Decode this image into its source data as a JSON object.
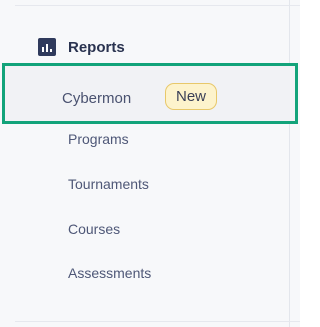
{
  "section": {
    "icon": "bar-chart-icon",
    "title": "Reports"
  },
  "active_item": {
    "label": "Cybermon",
    "badge": "New"
  },
  "items": [
    {
      "label": "Programs"
    },
    {
      "label": "Tournaments"
    },
    {
      "label": "Courses"
    },
    {
      "label": "Assessments"
    }
  ],
  "colors": {
    "highlight_border": "#12a37a",
    "badge_background": "#fdf3cc",
    "badge_border": "#e8c86a",
    "icon": "#2f3a5c"
  }
}
